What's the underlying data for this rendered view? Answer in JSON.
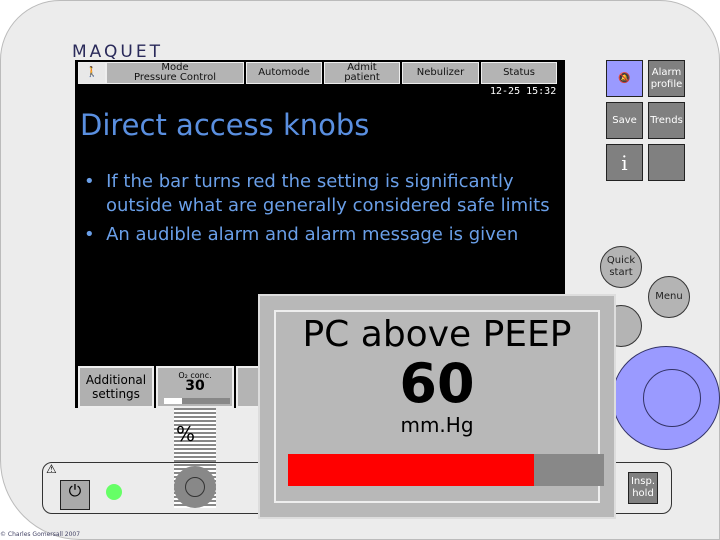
{
  "brand": "MAQUET",
  "top_bar": {
    "mode_label": "Mode",
    "mode_value": "Pressure Control",
    "automode": "Automode",
    "admit": "Admit patient",
    "nebulizer": "Nebulizer",
    "status": "Status",
    "datetime": "12-25 15:32"
  },
  "main": {
    "heading": "Direct access knobs",
    "bullets": [
      "If the bar turns red the setting is significantly outside what are generally considered safe limits",
      "An audible alarm and alarm message is given"
    ]
  },
  "side": {
    "alarm_profile": "Alarm profile",
    "save": "Save",
    "trends": "Trends",
    "info": "i",
    "quick_start": "Quick start",
    "menu": "Menu",
    "insp_hold": "Insp. hold"
  },
  "bottom": {
    "additional_settings": "Additional settings",
    "o2_label": "O₂ conc.",
    "o2_value": "30",
    "unit_percent": "%"
  },
  "popup": {
    "title": "PC above PEEP",
    "value": "60",
    "unit": "mm.Hg",
    "bar_fraction": 0.78,
    "bar_color": "#ff0000"
  },
  "copyright": "© Charles Gomersall 2007"
}
